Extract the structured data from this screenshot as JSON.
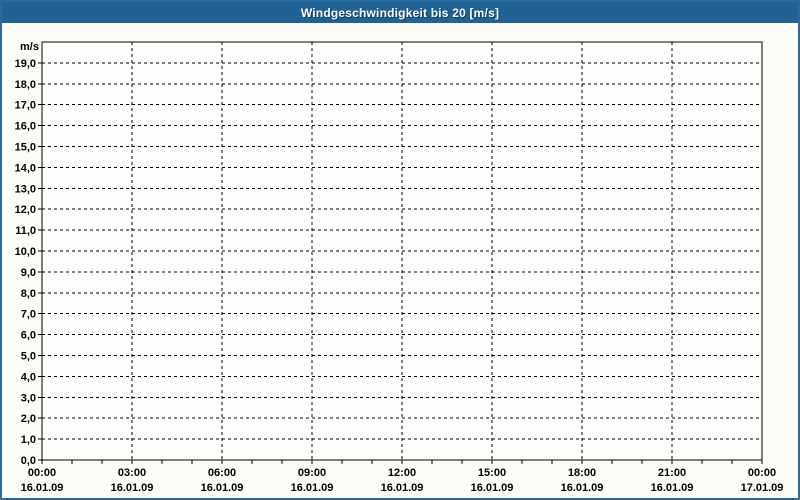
{
  "window": {
    "title": "Windgeschwindigkeit bis 20 [m/s]"
  },
  "colors": {
    "title_bar_bg": "#1f6396",
    "title_bar_fg": "#ffffff",
    "page_border": "#2b6a9c",
    "page_bg": "#fcfdf8",
    "plot_bg": "#fefffd",
    "grid": "#000000",
    "label": "#000000"
  },
  "chart_data": {
    "type": "line",
    "title": "Windgeschwindigkeit bis 20 [m/s]",
    "ylabel": "m/s",
    "y_unit_label": "m/s",
    "ylim": [
      0,
      20
    ],
    "y_tick_step": 1.0,
    "y_tick_labels": [
      "0,0",
      "1,0",
      "2,0",
      "3,0",
      "4,0",
      "5,0",
      "6,0",
      "7,0",
      "8,0",
      "9,0",
      "10,0",
      "11,0",
      "12,0",
      "13,0",
      "14,0",
      "15,0",
      "16,0",
      "17,0",
      "18,0",
      "19,0"
    ],
    "grid": "dashed",
    "legend": "none",
    "x_axis": {
      "major_ticks": [
        {
          "time": "00:00",
          "date": "16.01.09"
        },
        {
          "time": "03:00",
          "date": "16.01.09"
        },
        {
          "time": "06:00",
          "date": "16.01.09"
        },
        {
          "time": "09:00",
          "date": "16.01.09"
        },
        {
          "time": "12:00",
          "date": "16.01.09"
        },
        {
          "time": "15:00",
          "date": "16.01.09"
        },
        {
          "time": "18:00",
          "date": "16.01.09"
        },
        {
          "time": "21:00",
          "date": "16.01.09"
        },
        {
          "time": "00:00",
          "date": "17.01.09"
        }
      ],
      "minor_ticks_per_major": 3
    },
    "series": []
  }
}
